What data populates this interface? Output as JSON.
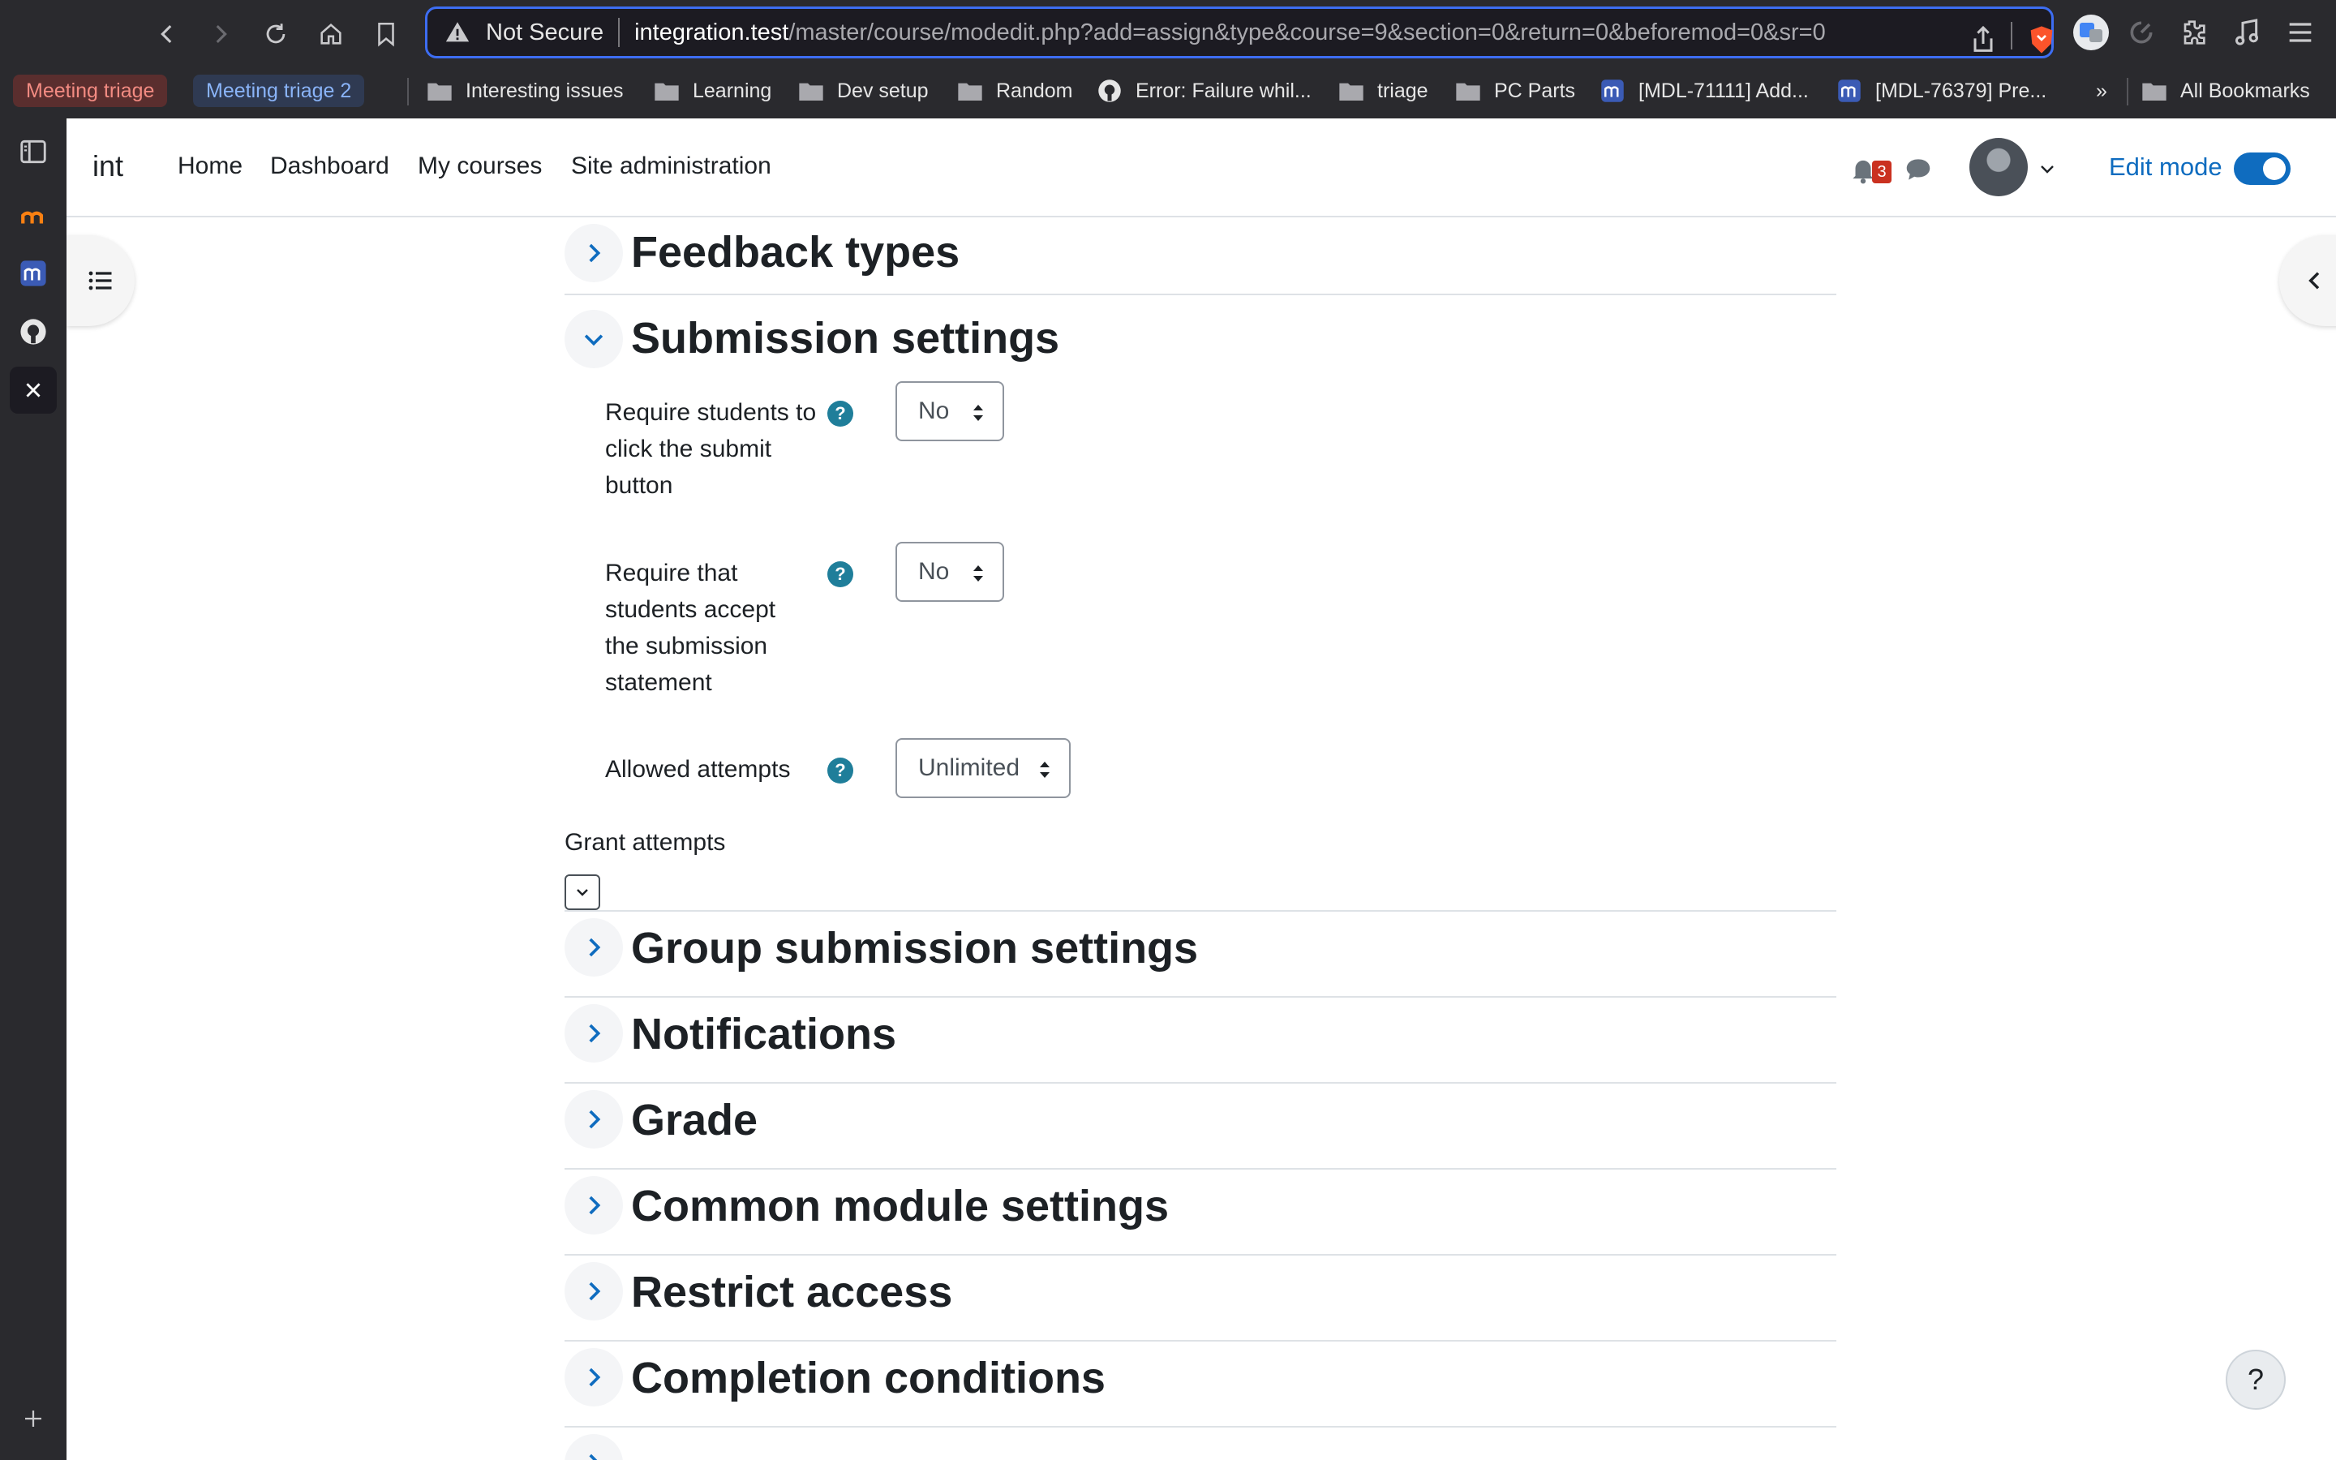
{
  "browser": {
    "url_warning": "Not Secure",
    "url_host": "integration.test",
    "url_path": "/master/course/modedit.php?add=assign&type&course=9&section=0&return=0&beforemod=0&sr=0",
    "bookmarks": {
      "pill1": "Meeting triage",
      "pill2": "Meeting triage 2",
      "items": [
        "Interesting issues",
        "Learning",
        "Dev setup",
        "Random",
        "Error: Failure whil...",
        "triage",
        "PC Parts",
        "[MDL-71111] Add...",
        "[MDL-76379] Pre..."
      ],
      "overflow": "»",
      "all": "All Bookmarks"
    },
    "colors": {
      "chrome": "#2a2a2e",
      "url_focus": "#3d6df2",
      "pill1_bg": "#5a2e2e",
      "pill1_fg": "#f28b82",
      "pill2_bg": "#2f3a52",
      "pill2_fg": "#8ab4f8"
    }
  },
  "moodle": {
    "brand": "int",
    "nav": {
      "home": "Home",
      "dashboard": "Dashboard",
      "my_courses": "My courses",
      "site_admin": "Site administration"
    },
    "notifications_count": "3",
    "edit_mode_label": "Edit mode",
    "edit_mode_on": true,
    "accent": "#0f6cbf"
  },
  "form": {
    "sections": {
      "feedback_types": "Feedback types",
      "submission_settings": "Submission settings",
      "group_submission": "Group submission settings",
      "notifications": "Notifications",
      "grade": "Grade",
      "common_module": "Common module settings",
      "restrict_access": "Restrict access",
      "completion": "Completion conditions"
    },
    "fields": {
      "require_submit_label": "Require students to click the submit button",
      "require_submit_value": "No",
      "require_statement_label": "Require that students accept the submission statement",
      "require_statement_value": "No",
      "allowed_attempts_label": "Allowed attempts",
      "allowed_attempts_value": "Unlimited",
      "grant_attempts_label": "Grant attempts"
    },
    "help_glyph": "?"
  },
  "footer": {
    "help_button": "?"
  }
}
